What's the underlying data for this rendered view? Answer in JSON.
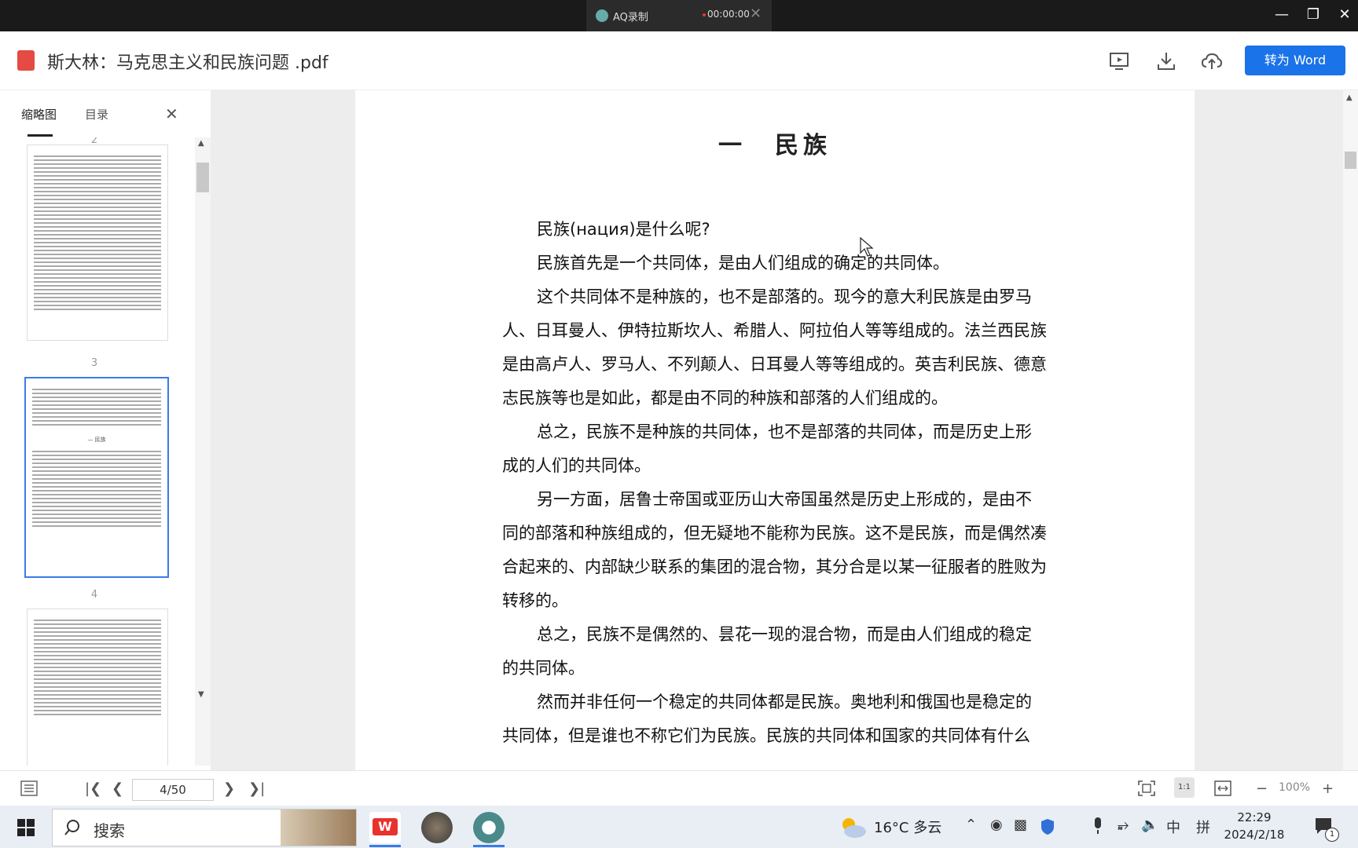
{
  "recorder": {
    "title": "AQ录制",
    "timer": "00:00:00"
  },
  "header": {
    "title": "斯大林：马克思主义和民族问题 .pdf",
    "convert_label": "转为 Word"
  },
  "sidebar": {
    "tab_thumbnails": "缩略图",
    "tab_toc": "目录",
    "page_labels": [
      "3",
      "4"
    ],
    "partial_label": "2"
  },
  "document": {
    "chapter_title": "一　民族",
    "paragraphs": [
      "民族(нация)是什么呢?",
      "民族首先是一个共同体，是由人们组成的确定的共同体。",
      "这个共同体不是种族的，也不是部落的。现今的意大利民族是由罗马人、日耳曼人、伊特拉斯坎人、希腊人、阿拉伯人等等组成的。法兰西民族是由高卢人、罗马人、不列颠人、日耳曼人等等组成的。英吉利民族、德意志民族等也是如此，都是由不同的种族和部落的人们组成的。",
      "总之，民族不是种族的共同体，也不是部落的共同体，而是历史上形成的人们的共同体。",
      "另一方面，居鲁士帝国或亚历山大帝国虽然是历史上形成的，是由不同的部落和种族组成的，但无疑地不能称为民族。这不是民族，而是偶然凑合起来的、内部缺少联系的集团的混合物，其分合是以某一征服者的胜败为转移的。",
      "总之，民族不是偶然的、昙花一现的混合物，而是由人们组成的稳定的共同体。",
      "然而并非任何一个稳定的共同体都是民族。奥地利和俄国也是稳定的共同体，但是谁也不称它们为民族。民族的共同体和国家的共同体有什么"
    ]
  },
  "bottombar": {
    "page_indicator": "4/50",
    "zoom": "100%"
  },
  "taskbar": {
    "search_label": "搜索",
    "weather": "16°C 多云",
    "ime_lang": "中",
    "ime_mode": "拼",
    "time": "22:29",
    "date": "2024/2/18",
    "notification_count": "1"
  },
  "colors": {
    "accent": "#1a73e8",
    "pdf_red": "#e34b43",
    "titlebar": "#1a1a1a"
  }
}
